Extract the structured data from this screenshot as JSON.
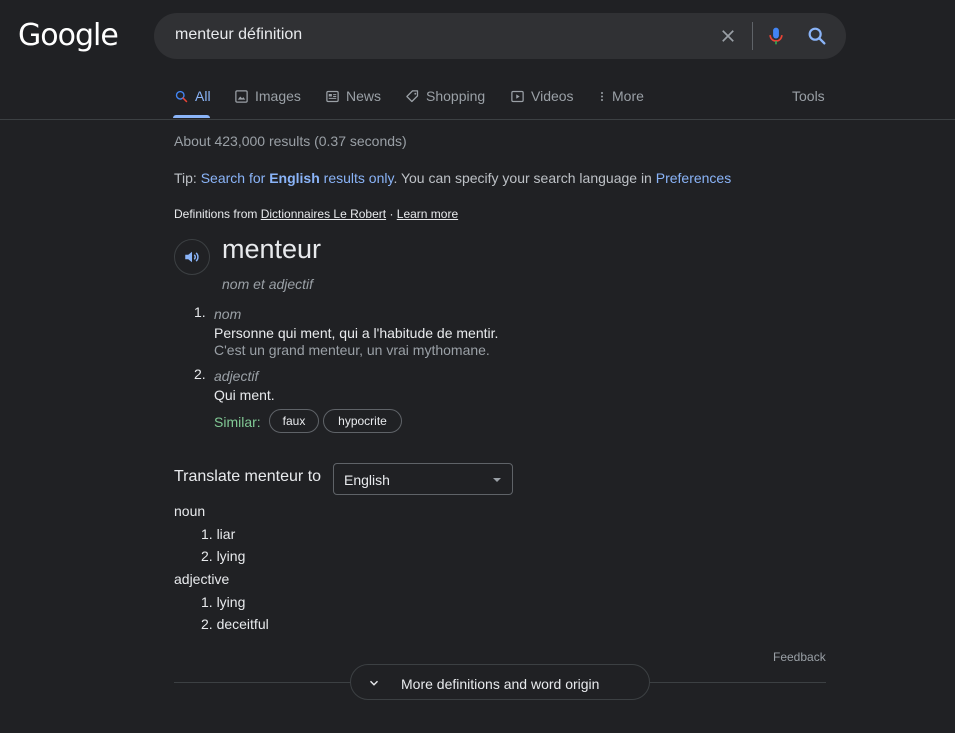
{
  "logo": "Google",
  "search": {
    "query": "menteur définition"
  },
  "tabs": [
    {
      "label": "All",
      "icon": "search-icon",
      "active": true
    },
    {
      "label": "Images",
      "icon": "image-icon"
    },
    {
      "label": "News",
      "icon": "news-icon"
    },
    {
      "label": "Shopping",
      "icon": "tag-icon"
    },
    {
      "label": "Videos",
      "icon": "play-icon"
    },
    {
      "label": "More",
      "icon": "more-vert-icon"
    }
  ],
  "tools_label": "Tools",
  "stats": "About 423,000 results (0.37 seconds)",
  "tip": {
    "prefix": "Tip: ",
    "link_start": "Search for ",
    "bold": "English",
    "link_end": " results only",
    "middle": ". You can specify your search language in ",
    "pref_link": "Preferences"
  },
  "definitions": {
    "from_label": "Definitions from ",
    "source": "Dictionnaires Le Robert",
    "separator": " · ",
    "learn_more": "Learn more",
    "word": "menteur",
    "part_of_speech": "nom et adjectif",
    "senses": [
      {
        "num": "1.",
        "pos": "nom",
        "definition": "Personne qui ment, qui a l'habitude de mentir.",
        "example": "C'est un grand menteur, un vrai mythomane."
      },
      {
        "num": "2.",
        "pos": "adjectif",
        "definition": "Qui ment."
      }
    ],
    "similar_label": "Similar:",
    "similar": [
      "faux",
      "hypocrite"
    ]
  },
  "translate": {
    "label": "Translate menteur to",
    "language": "English",
    "groups": [
      {
        "pos": "noun",
        "items": [
          "1. liar",
          "2. lying"
        ]
      },
      {
        "pos": "adjective",
        "items": [
          "1. lying",
          "2. deceitful"
        ]
      }
    ]
  },
  "feedback": "Feedback",
  "more_button": "More definitions and word origin",
  "colors": {
    "background": "#202124",
    "link": "#8ab4f8",
    "similar": "#81c995"
  }
}
